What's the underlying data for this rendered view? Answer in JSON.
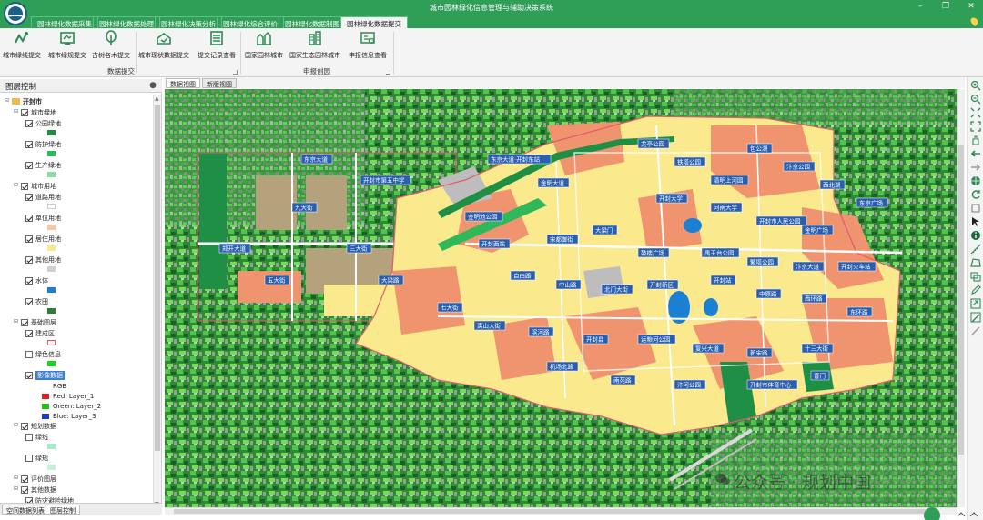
{
  "app": {
    "title": "城市园林绿化信息管理与辅助决策系统"
  },
  "menu_tabs": [
    {
      "label": "园林绿化数据采集"
    },
    {
      "label": "园林绿化数据处理"
    },
    {
      "label": "园林绿化决策分析"
    },
    {
      "label": "园林绿化综合评价"
    },
    {
      "label": "园林绿化数据制图"
    },
    {
      "label": "园林绿化数据提交"
    }
  ],
  "ribbon": {
    "buttons": [
      {
        "label": "城市绿线提交",
        "icon": "green-line-icon"
      },
      {
        "label": "城市绿规提交",
        "icon": "green-plan-icon"
      },
      {
        "label": "古树名木提交",
        "icon": "ancient-tree-icon"
      },
      {
        "label": "城市现状数据提交",
        "icon": "status-data-icon"
      },
      {
        "label": "提交记录查看",
        "icon": "record-list-icon"
      },
      {
        "label": "国家园林城市",
        "icon": "garden-city-icon"
      },
      {
        "label": "国家生态园林城市",
        "icon": "eco-city-icon"
      },
      {
        "label": "申报信息查看",
        "icon": "declare-info-icon"
      }
    ],
    "groups": [
      {
        "label": "数据提交"
      },
      {
        "label": "申报创园"
      }
    ]
  },
  "layer_panel": {
    "title": "图层控制",
    "rgb_label": "RGB",
    "rgb_bands": [
      {
        "text": "Red:    Layer_1",
        "color": "#e0201c"
      },
      {
        "text": "Green: Layer_2",
        "color": "#23c21b"
      },
      {
        "text": "Blue:   Layer_3",
        "color": "#2438d8"
      }
    ],
    "items": [
      {
        "level": 0,
        "label": "开封市",
        "checked": true
      },
      {
        "level": 1,
        "label": "城市绿地",
        "checked": true
      },
      {
        "level": 2,
        "label": "公园绿地",
        "checked": true,
        "swatch": "#1f8f45"
      },
      {
        "level": 2,
        "label": "防护绿地",
        "checked": true,
        "swatch": "#2fb85a"
      },
      {
        "level": 2,
        "label": "生产绿地",
        "checked": true,
        "swatch": "#8fdca0"
      },
      {
        "level": 1,
        "label": "城市用地",
        "checked": true
      },
      {
        "level": 2,
        "label": "道路用地",
        "checked": true,
        "swatch": "#ffffff"
      },
      {
        "level": 2,
        "label": "单位用地",
        "checked": true,
        "swatch": "#f6c7a9"
      },
      {
        "level": 2,
        "label": "居住用地",
        "checked": true,
        "swatch": "#fbe98e"
      },
      {
        "level": 2,
        "label": "其他用地",
        "checked": true,
        "swatch": "#cfcfcf"
      },
      {
        "level": 2,
        "label": "水体",
        "checked": true,
        "swatch": "#1b7fd4"
      },
      {
        "level": 2,
        "label": "农田",
        "checked": true,
        "swatch": "#2a7f3a"
      },
      {
        "level": 1,
        "label": "基础图层",
        "checked": true
      },
      {
        "level": 2,
        "label": "建成区",
        "checked": true,
        "outline": "#e05b6b"
      },
      {
        "level": 2,
        "label": "绿色信息",
        "checked": false,
        "swatch": "#19d61d"
      },
      {
        "level": 2,
        "label": "影像数据",
        "checked": true,
        "selected": true
      },
      {
        "level": 1,
        "label": "规划数据",
        "checked": true
      },
      {
        "level": 2,
        "label": "绿线",
        "checked": false,
        "swatch": "#a7ecc4"
      },
      {
        "level": 2,
        "label": "绿规",
        "checked": false,
        "swatch": "#c7f0d6"
      },
      {
        "level": 1,
        "label": "评价图层",
        "checked": true
      },
      {
        "level": 1,
        "label": "其他数据",
        "checked": true
      },
      {
        "level": 2,
        "label": "防灾避险绿地",
        "checked": true
      }
    ]
  },
  "bottom_tabs": [
    {
      "label": "空间数据列表"
    },
    {
      "label": "图层控制"
    }
  ],
  "map_tabs": [
    {
      "label": "数据视图"
    },
    {
      "label": "新版视图"
    }
  ],
  "map": {
    "labels": [
      "东京大道",
      "东京大道·开封东站",
      "金明大道",
      "九大街",
      "郑开大道",
      "三大街",
      "五大街",
      "大梁路",
      "七大街",
      "开封市第五中学",
      "金明池公园",
      "龙亭公园",
      "铁塔公园",
      "清明上河园",
      "包公湖",
      "汴京公园",
      "西北湖",
      "东京广场",
      "开封大学",
      "河南大学",
      "开封市人民公园",
      "金明广场",
      "开封西站",
      "宋都御街",
      "大梁门",
      "鼓楼广场",
      "禹王台公园",
      "繁塔公园",
      "汴京大道",
      "开封火车站",
      "自由路",
      "中山路",
      "北门大街",
      "开封新区",
      "开封站",
      "中原路",
      "西环路",
      "东环路",
      "夷山大街",
      "滨河路",
      "开封县",
      "运粮河公园",
      "复兴大道",
      "新宋路",
      "十三大街",
      "机场北路",
      "南苑路",
      "汴河公园",
      "开封市体育中心",
      "曹门"
    ]
  },
  "watermark": {
    "text": "公众号 · 规划中国"
  }
}
